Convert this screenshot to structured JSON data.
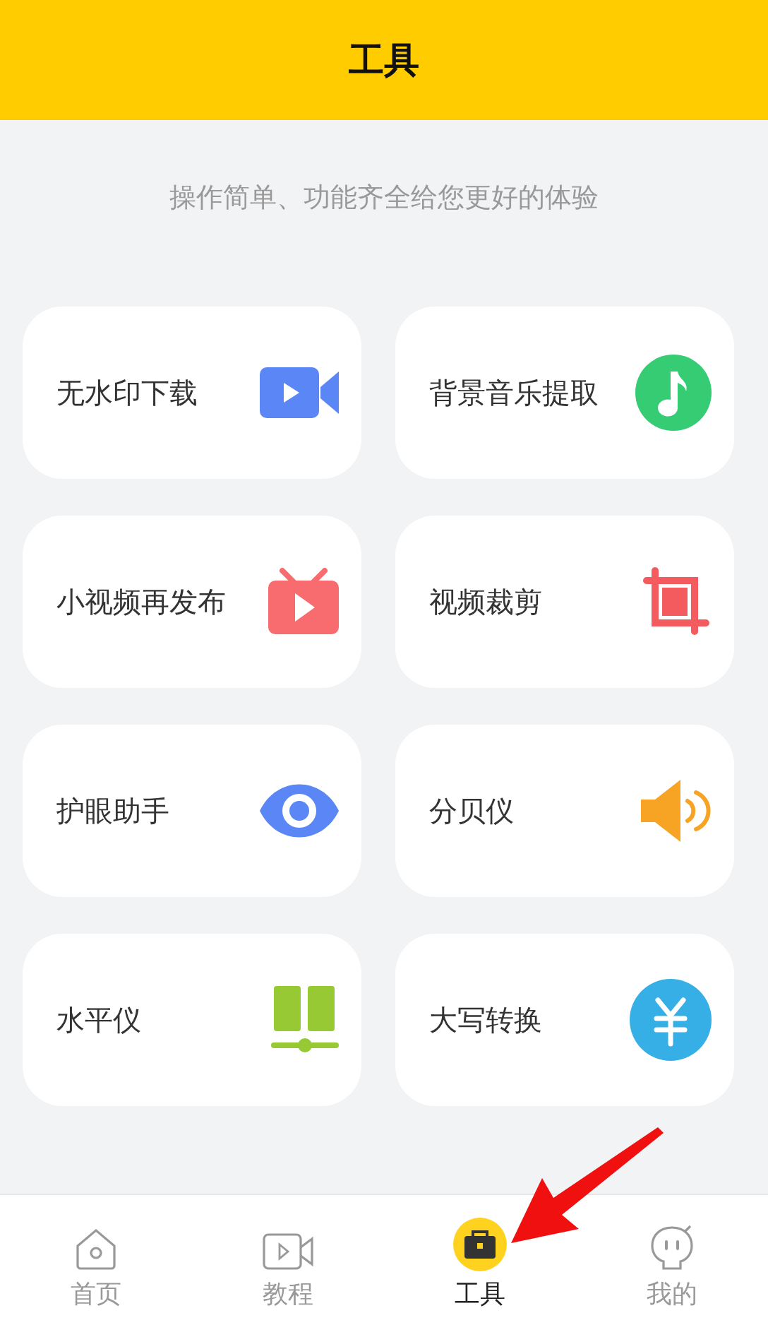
{
  "header": {
    "title": "工具"
  },
  "subtitle": "操作简单、功能齐全给您更好的体验",
  "tools": [
    {
      "label": "无水印下载",
      "kind": "video",
      "color": "#5b86f5"
    },
    {
      "label": "背景音乐提取",
      "kind": "music",
      "color": "#36cc74"
    },
    {
      "label": "小视频再发布",
      "kind": "tv",
      "color": "#f86c6f"
    },
    {
      "label": "视频裁剪",
      "kind": "crop",
      "color": "#f45b5e"
    },
    {
      "label": "护眼助手",
      "kind": "eye",
      "color": "#5b86f5"
    },
    {
      "label": "分贝仪",
      "kind": "speaker",
      "color": "#f7a323"
    },
    {
      "label": "水平仪",
      "kind": "level",
      "color": "#97c934"
    },
    {
      "label": "大写转换",
      "kind": "yuan",
      "color": "#36aee6"
    }
  ],
  "tabbar": [
    {
      "label": "首页",
      "kind": "home",
      "selected": false
    },
    {
      "label": "教程",
      "kind": "video",
      "selected": false
    },
    {
      "label": "工具",
      "kind": "toolbox",
      "selected": true
    },
    {
      "label": "我的",
      "kind": "face",
      "selected": false
    }
  ]
}
